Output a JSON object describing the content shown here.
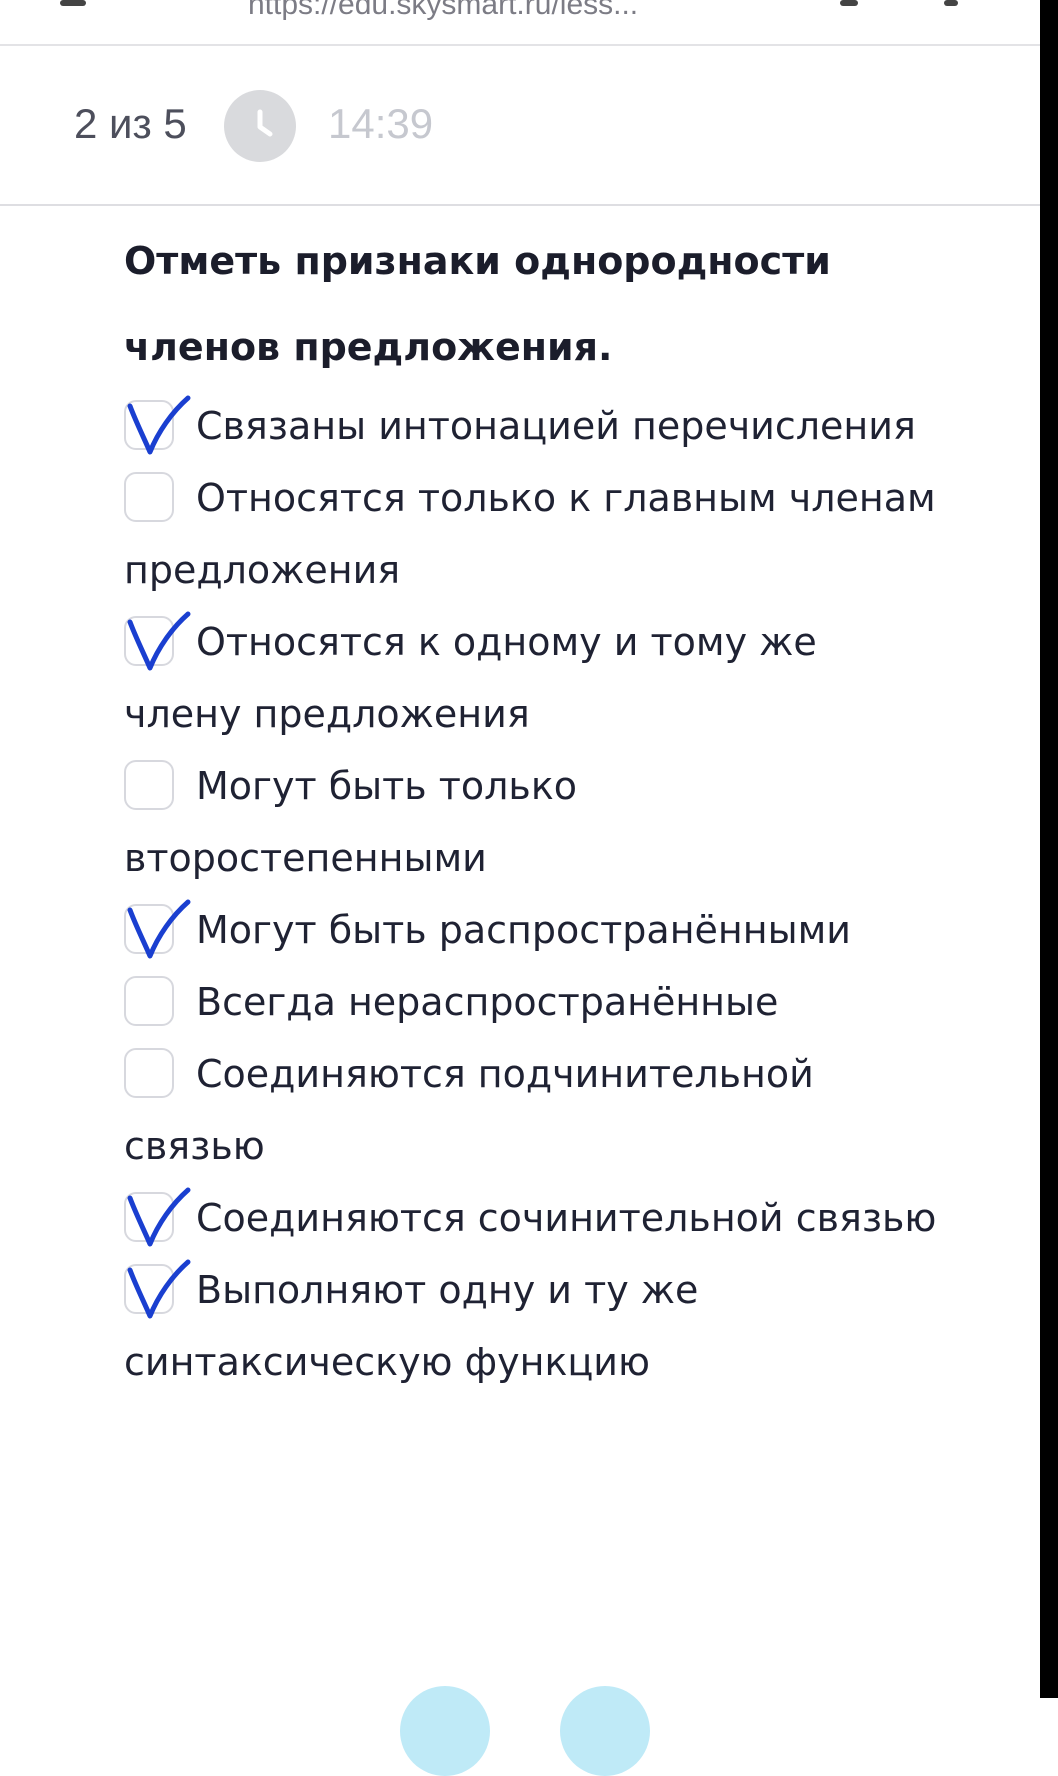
{
  "browser": {
    "url": "https://edu.skysmart.ru/less..."
  },
  "header": {
    "progress": "2 из 5",
    "timer_icon": "clock-icon",
    "timer": "14:39"
  },
  "question": {
    "title": "Отметь признаки однородности членов предложения."
  },
  "options": [
    {
      "text": "Связаны интонацией перечисления",
      "checked": true
    },
    {
      "text": "Относятся только к главным членам предложения",
      "checked": false
    },
    {
      "text": "Относятся к одному и тому же члену предложения",
      "checked": true
    },
    {
      "text": "Могут быть только второстепенными",
      "checked": false
    },
    {
      "text": "Могут быть распространёнными",
      "checked": true
    },
    {
      "text": "Всегда нераспространённые",
      "checked": false
    },
    {
      "text": "Соединяются подчинительной связью",
      "checked": false
    },
    {
      "text": "Соединяются сочинительной связью",
      "checked": true
    },
    {
      "text": "Выполняют одну и ту же синтаксическую функцию",
      "checked": true
    }
  ],
  "colors": {
    "handwritten_mark": "#1a3fd0",
    "timer_inactive": "#c6c8cf",
    "nav_button": "#bfeaf7"
  }
}
